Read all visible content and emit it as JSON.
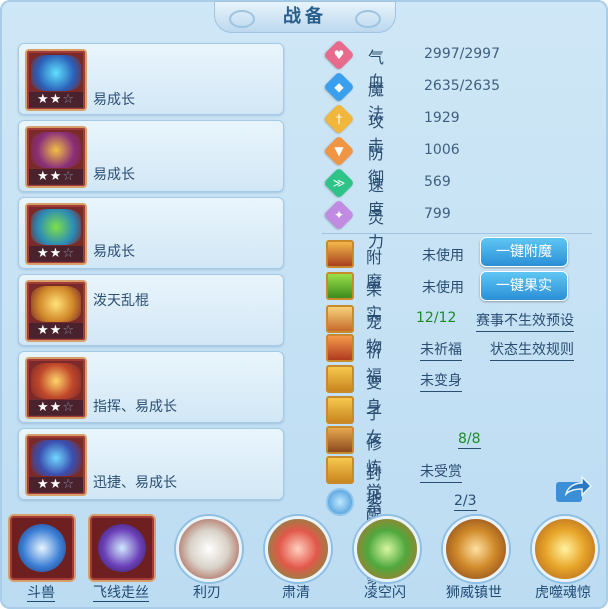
{
  "title": "战备",
  "equipment": [
    {
      "label": "易成长",
      "stars": "★★☆"
    },
    {
      "label": "易成长",
      "stars": "★★☆"
    },
    {
      "label": "易成长",
      "stars": "★★☆"
    },
    {
      "label": "泼天乱棍",
      "stars": "★★☆"
    },
    {
      "label": "指挥、易成长",
      "stars": "★★☆"
    },
    {
      "label": "迅捷、易成长",
      "stars": "★★☆"
    }
  ],
  "stats": [
    {
      "name": "气血",
      "value": "2997/2997",
      "color": "#e86b8e",
      "icon": "heart-icon"
    },
    {
      "name": "魔法",
      "value": "2635/2635",
      "color": "#3aa0ee",
      "icon": "diamond-icon"
    },
    {
      "name": "攻击",
      "value": "1929",
      "color": "#f0b73a",
      "icon": "sword-icon"
    },
    {
      "name": "防御",
      "value": "1006",
      "color": "#f19545",
      "icon": "shield-icon"
    },
    {
      "name": "速度",
      "value": "569",
      "color": "#2ec488",
      "icon": "speed-icon"
    },
    {
      "name": "灵力",
      "value": "799",
      "color": "#c08be0",
      "icon": "spirit-icon"
    }
  ],
  "attachments": {
    "enchant": {
      "name": "附魔",
      "value": "未使用",
      "button": "一键附魔"
    },
    "fruit": {
      "name": "果实",
      "value": "未使用",
      "button": "一键果实"
    },
    "pet": {
      "name": "宠物",
      "value": "12/12",
      "link": "赛事不生效预设"
    },
    "blessing": {
      "name": "祈福",
      "value": "未祈福",
      "link": "状态生效规则"
    },
    "transform": {
      "name": "变身",
      "value": "未变身"
    },
    "child": {
      "name": "子女"
    },
    "cultivation": {
      "name": "修炼觉醒",
      "value": "8/8"
    },
    "fief": {
      "name": "封地",
      "value": "未受赏"
    },
    "constellation": {
      "name": "系别星象",
      "value": "2/3"
    }
  },
  "skills": [
    {
      "name": "斗兽",
      "style": "square",
      "color": "#3d7fd6"
    },
    {
      "name": "飞线走丝",
      "style": "square",
      "color": "#6b3fb8"
    },
    {
      "name": "利刃",
      "style": "disc",
      "color": "#d8d2c8"
    },
    {
      "name": "肃清",
      "style": "disc",
      "color": "#e2584a"
    },
    {
      "name": "凌空闪",
      "style": "disc",
      "color": "#4fa83e"
    },
    {
      "name": "狮威镇世",
      "style": "disc",
      "color": "#d08a2a"
    },
    {
      "name": "虎噬魂惊",
      "style": "disc",
      "color": "#e8a62a"
    }
  ]
}
